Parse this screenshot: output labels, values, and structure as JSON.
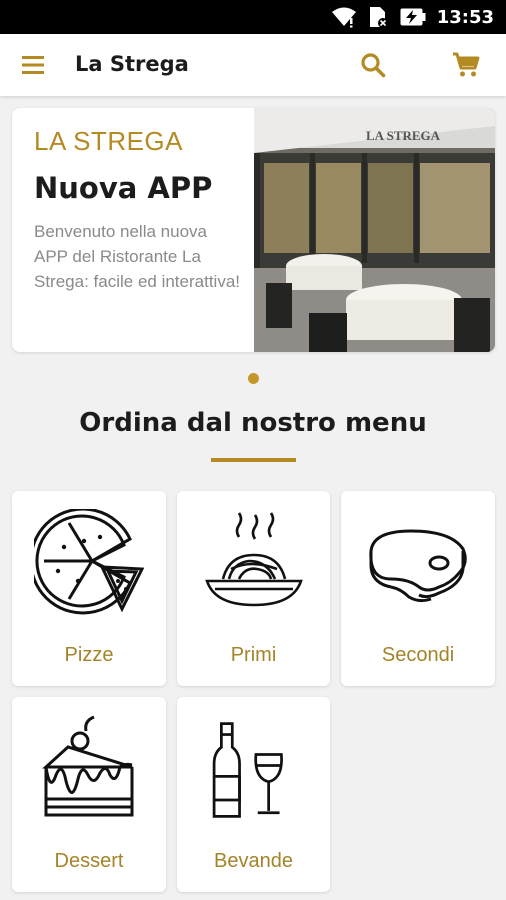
{
  "status_bar": {
    "time": "13:53"
  },
  "app_bar": {
    "title": "La Strega"
  },
  "banner": {
    "brand": "LA STREGA",
    "headline": "Nuova APP",
    "description": "Benvenuto nella nuova APP del Ristorante La Strega: facile ed interattiva!",
    "photo_sign": "LA STREGA"
  },
  "section": {
    "title": "Ordina dal nostro menu"
  },
  "categories": [
    {
      "label": "Pizze",
      "icon": "pizza-icon"
    },
    {
      "label": "Primi",
      "icon": "pasta-icon"
    },
    {
      "label": "Secondi",
      "icon": "steak-icon"
    },
    {
      "label": "Dessert",
      "icon": "cake-icon"
    },
    {
      "label": "Bevande",
      "icon": "drinks-icon"
    }
  ],
  "colors": {
    "accent": "#b38b22",
    "background": "#f1f1f1",
    "card": "#ffffff"
  }
}
